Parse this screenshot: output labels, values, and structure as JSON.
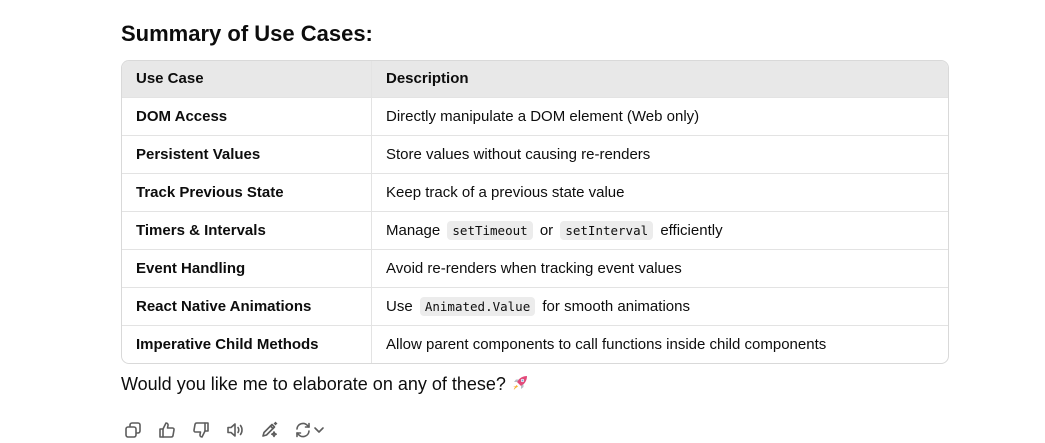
{
  "heading": "Summary of Use Cases:",
  "table": {
    "headers": [
      "Use Case",
      "Description"
    ],
    "rows": [
      {
        "use_case": "DOM Access",
        "desc": "Directly manipulate a DOM element (Web only)"
      },
      {
        "use_case": "Persistent Values",
        "desc": "Store values without causing re-renders"
      },
      {
        "use_case": "Track Previous State",
        "desc": "Keep track of a previous state value"
      },
      {
        "use_case": "Timers & Intervals",
        "desc_pre": "Manage",
        "code1": "setTimeout",
        "desc_mid": "or",
        "code2": "setInterval",
        "desc_post": "efficiently"
      },
      {
        "use_case": "Event Handling",
        "desc": "Avoid re-renders when tracking event values"
      },
      {
        "use_case": "React Native Animations",
        "desc_pre": "Use",
        "code1": "Animated.Value",
        "desc_post": "for smooth animations"
      },
      {
        "use_case": "Imperative Child Methods",
        "desc": "Allow parent components to call functions inside child components"
      }
    ]
  },
  "followup": "Would you like me to elaborate on any of these?",
  "followup_emoji": "rocket-icon",
  "actions": [
    {
      "icon": "copy-icon"
    },
    {
      "icon": "thumbs-up-icon"
    },
    {
      "icon": "thumbs-down-icon"
    },
    {
      "icon": "read-aloud-icon"
    },
    {
      "icon": "edit-in-canvas-icon"
    },
    {
      "icon": "regenerate-icon"
    }
  ],
  "colors": {
    "text": "#0d0d0d",
    "header_bg": "#e8e8e8",
    "border": "#d9d9d9",
    "code_bg": "#ececec",
    "icon": "#5d5d5d"
  }
}
